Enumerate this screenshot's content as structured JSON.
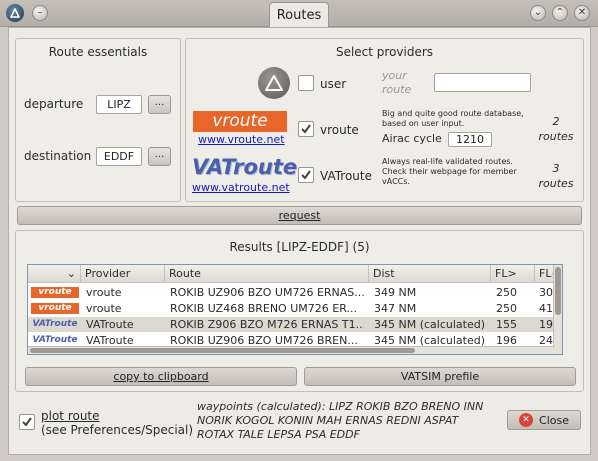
{
  "window": {
    "title": "Routes"
  },
  "route_essentials": {
    "title": "Route essentials",
    "departure_label": "departure",
    "departure_value": "LIPZ",
    "destination_label": "destination",
    "destination_value": "EDDF",
    "browse_label": "..."
  },
  "providers": {
    "title": "Select providers",
    "user": {
      "label": "user",
      "your_route_label": "your route",
      "input_value": ""
    },
    "vroute": {
      "logo_text": "vroute",
      "link": "www.vroute.net",
      "label": "vroute",
      "description": "Big and quite good route database, based on user input.",
      "airac_label": "Airac cycle",
      "airac_value": "1210",
      "count": "2",
      "count_unit": "routes",
      "checked": true
    },
    "vatroute": {
      "logo_text": "VATroute",
      "link": "www.vatroute.net",
      "label": "VATroute",
      "description": "Always real-life validated routes. Check their webpage for member vACCs.",
      "count": "3",
      "count_unit": "routes",
      "checked": true
    }
  },
  "request_label": "request",
  "results": {
    "title": "Results [LIPZ-EDDF] (5)",
    "columns": [
      "Provider",
      "Route",
      "Dist",
      "FL>",
      "FL<"
    ],
    "rows": [
      {
        "badge": "vroute",
        "provider": "vroute",
        "route": "ROKIB UZ906 BZO UM726 ERNAS...",
        "dist": "349 NM",
        "fl_out": "250",
        "fl_in": "305"
      },
      {
        "badge": "vroute",
        "provider": "vroute",
        "route": "ROKIB UZ468 BRENO UM726 ER...",
        "dist": "347 NM",
        "fl_out": "250",
        "fl_in": "410"
      },
      {
        "badge": "VATroute",
        "provider": "VATroute",
        "route": "ROKIB Z906 BZO M726 ERNAS T1...",
        "dist": "345 NM (calculated)",
        "fl_out": "155",
        "fl_in": "195"
      },
      {
        "badge": "VATroute",
        "provider": "VATroute",
        "route": "ROKIB UZ906 BZO UM726 BREN...",
        "dist": "345 NM (calculated)",
        "fl_out": "196",
        "fl_in": "245"
      }
    ]
  },
  "buttons": {
    "copy": "copy to clipboard",
    "vatsim": "VATSIM prefile",
    "close": "Close"
  },
  "plot_route": {
    "label": "plot route",
    "sublabel": "(see Preferences/Special)",
    "checked": true
  },
  "waypoints_text": "waypoints (calculated): LIPZ ROKIB BZO BRENO INN NORIK KOGOL KONIN MAH ERNAS REDNI ASPAT ROTAX TALE LEPSA PSA EDDF",
  "colors": {
    "vroute_orange": "#e8662a",
    "vatroute_blue": "#4a5fa8",
    "selected_row": "#ddd9d1"
  }
}
